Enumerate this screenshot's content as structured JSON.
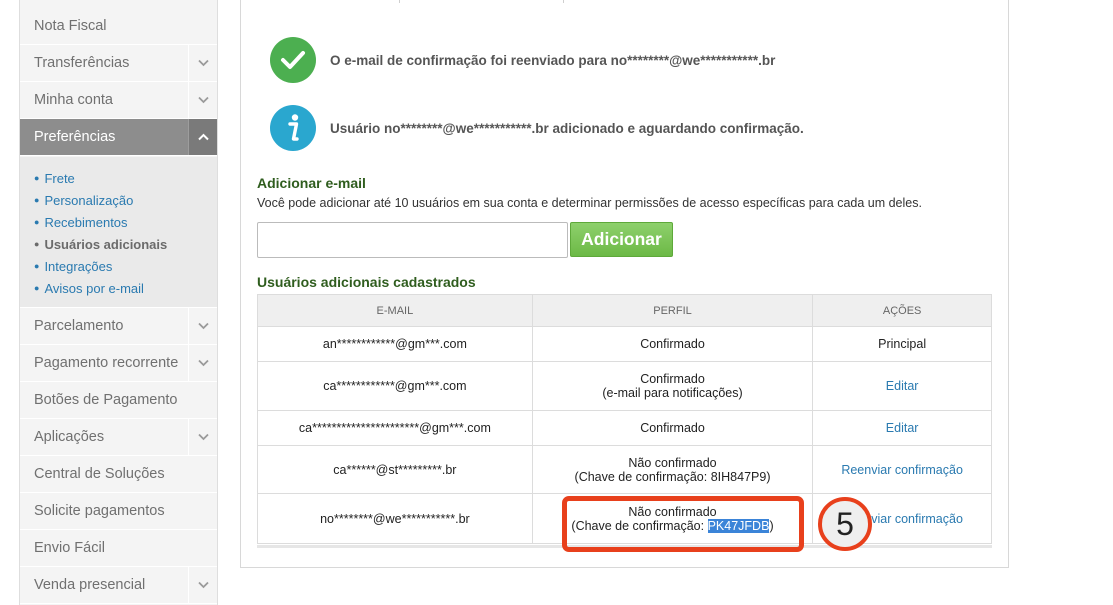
{
  "sidebar": {
    "items": [
      {
        "label": "Nota Fiscal"
      },
      {
        "label": "Transferências"
      },
      {
        "label": "Minha conta"
      },
      {
        "label": "Preferências"
      },
      {
        "label": "Parcelamento"
      },
      {
        "label": "Pagamento recorrente"
      },
      {
        "label": "Botões de Pagamento"
      },
      {
        "label": "Aplicações"
      },
      {
        "label": "Central de Soluções"
      },
      {
        "label": "Solicite pagamentos"
      },
      {
        "label": "Envio Fácil"
      },
      {
        "label": "Venda presencial"
      }
    ],
    "subitems": [
      {
        "label": "Frete"
      },
      {
        "label": "Personalização"
      },
      {
        "label": "Recebimentos"
      },
      {
        "label": "Usuários adicionais"
      },
      {
        "label": "Integrações"
      },
      {
        "label": "Avisos por e-mail"
      }
    ]
  },
  "messages": {
    "success": {
      "text": "O e-mail de confirmação foi reenviado para no********@we***********.br",
      "icon": "check-icon",
      "color": "#4caf50"
    },
    "info": {
      "text": "Usuário no********@we***********.br adicionado e aguardando confirmação.",
      "icon": "info-icon",
      "color": "#2aa7cf"
    }
  },
  "add_email": {
    "title": "Adicionar e-mail",
    "description": "Você pode adicionar até 10 usuários em sua conta e determinar permissões de acesso específicas para cada um deles.",
    "input_value": "",
    "button_label": "Adicionar"
  },
  "users_table": {
    "title": "Usuários adicionais cadastrados",
    "headers": {
      "email": "E-MAIL",
      "perfil": "PERFIL",
      "acoes": "AÇÕES"
    },
    "rows": [
      {
        "email": "an************@gm***.com",
        "perfil": "Confirmado",
        "perfil_note": "",
        "acao": "Principal",
        "acao_link": false
      },
      {
        "email": "ca************@gm***.com",
        "perfil": "Confirmado",
        "perfil_note": "(e-mail para notificações)",
        "acao": "Editar",
        "acao_link": true
      },
      {
        "email": "ca**********************@gm***.com",
        "perfil": "Confirmado",
        "perfil_note": "",
        "acao": "Editar",
        "acao_link": true
      },
      {
        "email": "ca******@st*********.br",
        "perfil": "Não confirmado",
        "perfil_note_prefix": "(Chave de confirmação: ",
        "perfil_key": "8IH847P9",
        "perfil_note_suffix": ")",
        "acao": "Reenviar confirmação",
        "acao_link": true
      },
      {
        "email": "no********@we***********.br",
        "perfil": "Não confirmado",
        "perfil_note_prefix": "(Chave de confirmação: ",
        "perfil_key": "PK47JFDB",
        "perfil_note_suffix": ")",
        "acao": "Reenviar confirmação",
        "acao_link": true
      }
    ]
  },
  "annotation": {
    "step_number": "5",
    "color": "#e8401c"
  },
  "colors": {
    "accent_link": "#2a7ab0",
    "sidebar_active": "#8d8d8d",
    "button_green": "#6cb946",
    "section_title": "#2f5d1e"
  }
}
